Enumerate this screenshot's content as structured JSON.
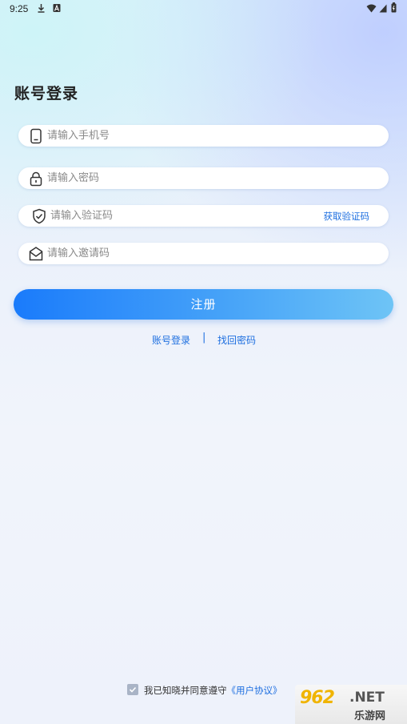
{
  "status_bar": {
    "time": "9:25"
  },
  "header": {
    "title": "账号登录"
  },
  "form": {
    "phone": {
      "placeholder": "请输入手机号",
      "value": ""
    },
    "password": {
      "placeholder": "请输入密码",
      "value": ""
    },
    "verification": {
      "placeholder": "请输入验证码",
      "value": "",
      "get_code_label": "获取验证码"
    },
    "invite": {
      "placeholder": "请输入邀请码",
      "value": ""
    },
    "register_label": "注册"
  },
  "links": {
    "login_label": "账号登录",
    "separator": "|",
    "recover_label": "找回密码"
  },
  "agreement": {
    "checked": true,
    "text": "我已知晓并同意遵守",
    "link_label": "《用户协议》"
  },
  "watermark": {
    "logo": "962",
    "suffix": ".NET",
    "name": "乐游网"
  },
  "colors": {
    "accent": "#1e6fe0",
    "button_start": "#1a7bfb",
    "button_end": "#6ec4f6",
    "checkbox": "#a9b4c6"
  },
  "icons": [
    "download-icon",
    "a-letter-icon",
    "wifi-icon",
    "signal-icon",
    "battery-icon",
    "phone-icon",
    "lock-icon",
    "shield-check-icon",
    "mail-icon",
    "check-icon"
  ]
}
